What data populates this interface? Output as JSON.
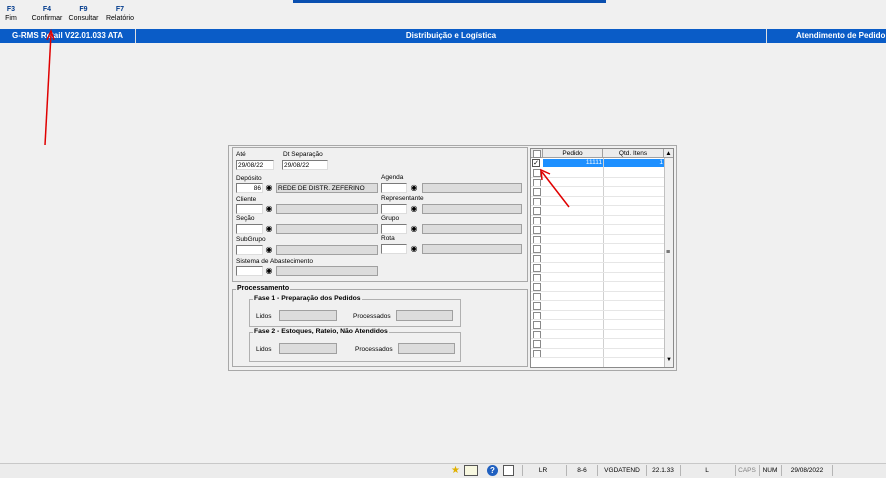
{
  "toolbar": {
    "keys": [
      {
        "key": "F3",
        "label": "Fim"
      },
      {
        "key": "F4",
        "label": "Confirmar"
      },
      {
        "key": "F9",
        "label": "Consultar"
      },
      {
        "key": "F7",
        "label": "Relatório"
      }
    ]
  },
  "titlebar": {
    "app": "G-RMS Retail V22.01.033 ATA",
    "module": "Distribuição e Logística",
    "screen": "Atendimento de Pedido"
  },
  "filters": {
    "ate_label": "Até",
    "ate_value": "29/08/22",
    "dt_separacao_label": "Dt Separação",
    "dt_separacao_value": "29/08/22",
    "deposito_label": "Depósito",
    "deposito_code": "86",
    "deposito_name": "REDE DE DISTR. ZEFERINO",
    "agenda_label": "Agenda",
    "cliente_label": "Cliente",
    "representante_label": "Representante",
    "secao_label": "Seção",
    "grupo_label": "Grupo",
    "subgrupo_label": "SubGrupo",
    "rota_label": "Rota",
    "sistema_label": "Sistema de Abastecimento"
  },
  "processamento": {
    "title": "Processamento",
    "fase1_title": "Fase 1 - Preparação dos Pedidos",
    "fase2_title": "Fase 2 - Estoques, Rateio, Não Atendidos",
    "lidos_label": "Lidos",
    "processados_label": "Processados"
  },
  "grid": {
    "columns": [
      "Pedido",
      "Qtd. Itens"
    ],
    "rows": [
      {
        "pedido": "11111",
        "qtd": "1",
        "checked": true,
        "selected": true
      }
    ]
  },
  "statusbar": {
    "mode": "LR",
    "version_code": "8-6",
    "program": "VGDATEND",
    "version": "22.1.33",
    "l": "L",
    "caps": "CAPS",
    "num": "NUM",
    "date": "29/08/2022"
  },
  "colors": {
    "titlebar": "#0a5cc7",
    "selection": "#1e90ff",
    "annotation_arrow": "#e00000"
  }
}
